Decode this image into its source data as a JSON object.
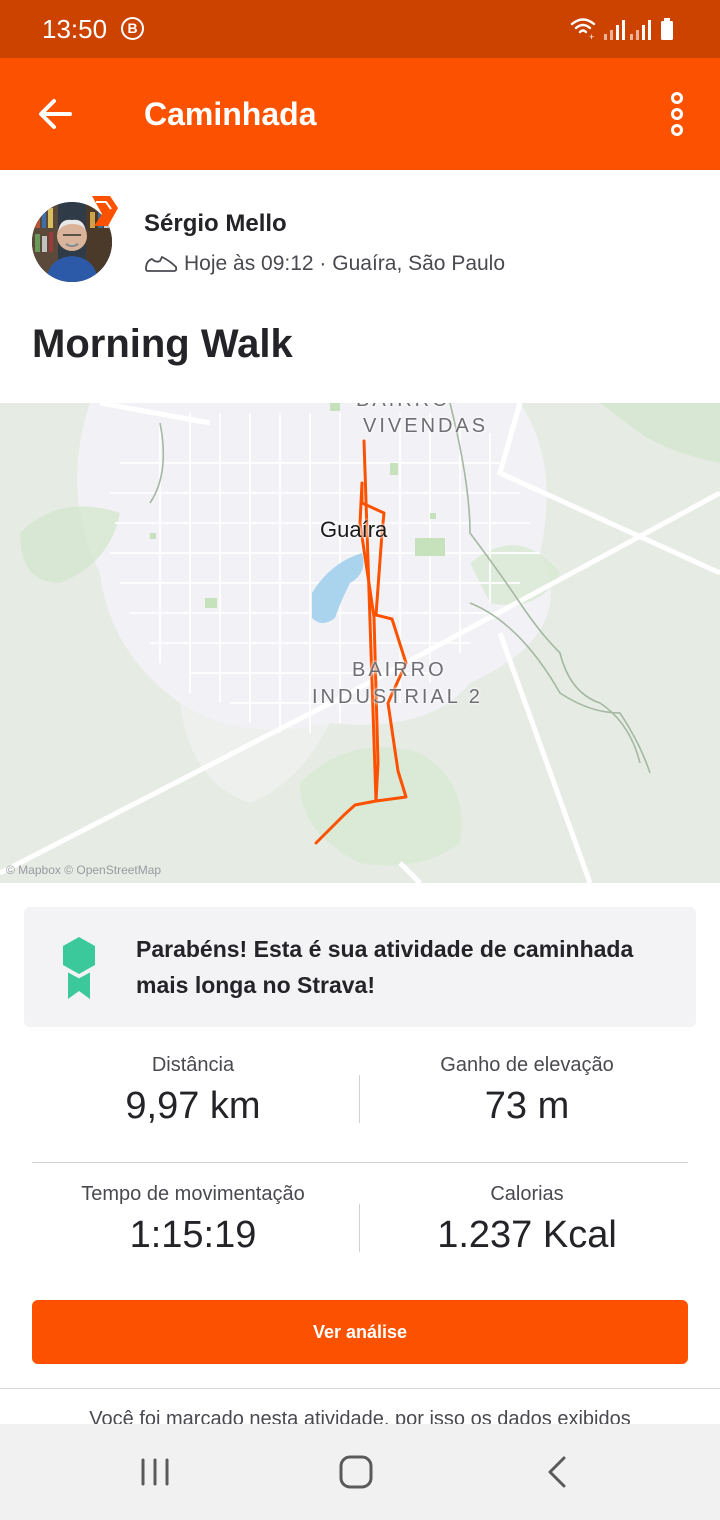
{
  "status_bar": {
    "time": "13:50",
    "badge": "B"
  },
  "app_bar": {
    "title": "Caminhada"
  },
  "athlete": {
    "name": "Sérgio Mello",
    "meta": "Hoje às 09:12 · Guaíra, São Paulo"
  },
  "activity": {
    "title": "Morning Walk"
  },
  "map": {
    "labels": {
      "vivendas_top": "BAIRRO",
      "vivendas": "VIVENDAS",
      "city": "Guaíra",
      "industrial_top": "BAIRRO",
      "industrial": "INDUSTRIAL 2"
    },
    "attribution": "© Mapbox © OpenStreetMap",
    "route_color": "#fc5200"
  },
  "achievement": {
    "text": "Parabéns! Esta é sua atividade de caminhada mais longa no Strava!"
  },
  "stats": [
    {
      "label": "Distância",
      "value": "9,97 km"
    },
    {
      "label": "Ganho de elevação",
      "value": "73 m"
    },
    {
      "label": "Tempo de movimentação",
      "value": "1:15:19"
    },
    {
      "label": "Calorias",
      "value": "1.237 Kcal"
    }
  ],
  "actions": {
    "analysis_label": "Ver análise"
  },
  "footer": {
    "tag_note": "Você foi marcado nesta atividade, por isso os dados exibidos"
  },
  "colors": {
    "brand": "#fc5200",
    "status_bar": "#cc4300",
    "medal": "#3bc99c"
  },
  "icons": {
    "back": "arrow-left-icon",
    "more": "more-vertical-icon",
    "shoe": "shoe-icon",
    "medal": "medal-icon",
    "wifi": "wifi-icon",
    "signal": "signal-icon",
    "battery": "battery-icon",
    "recent_apps": "recent-apps-icon",
    "home": "home-icon",
    "nav_back": "nav-back-icon"
  }
}
